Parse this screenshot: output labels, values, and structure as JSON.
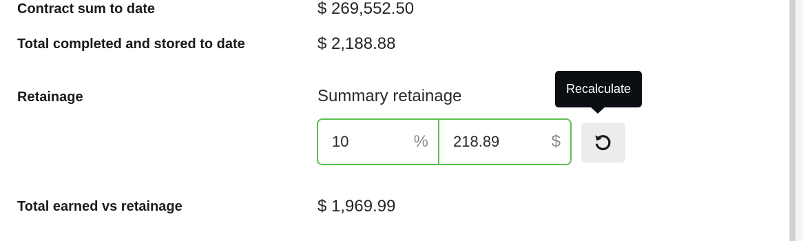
{
  "rows": {
    "contract_sum": {
      "label": "Contract sum to date",
      "value": "$ 269,552.50"
    },
    "completed_stored": {
      "label": "Total completed and stored to date",
      "value": "$ 2,188.88"
    },
    "retainage": {
      "label": "Retainage"
    },
    "earned_vs_retainage": {
      "label": "Total earned vs retainage",
      "value": "$ 1,969.99"
    }
  },
  "summary_retainage": {
    "title": "Summary retainage",
    "percent_value": "10",
    "percent_unit": "%",
    "amount_value": "218.89",
    "amount_unit": "$",
    "recalculate_icon": "rotate-ccw-icon",
    "tooltip": "Recalculate",
    "accent_color": "#5cbf4e"
  }
}
